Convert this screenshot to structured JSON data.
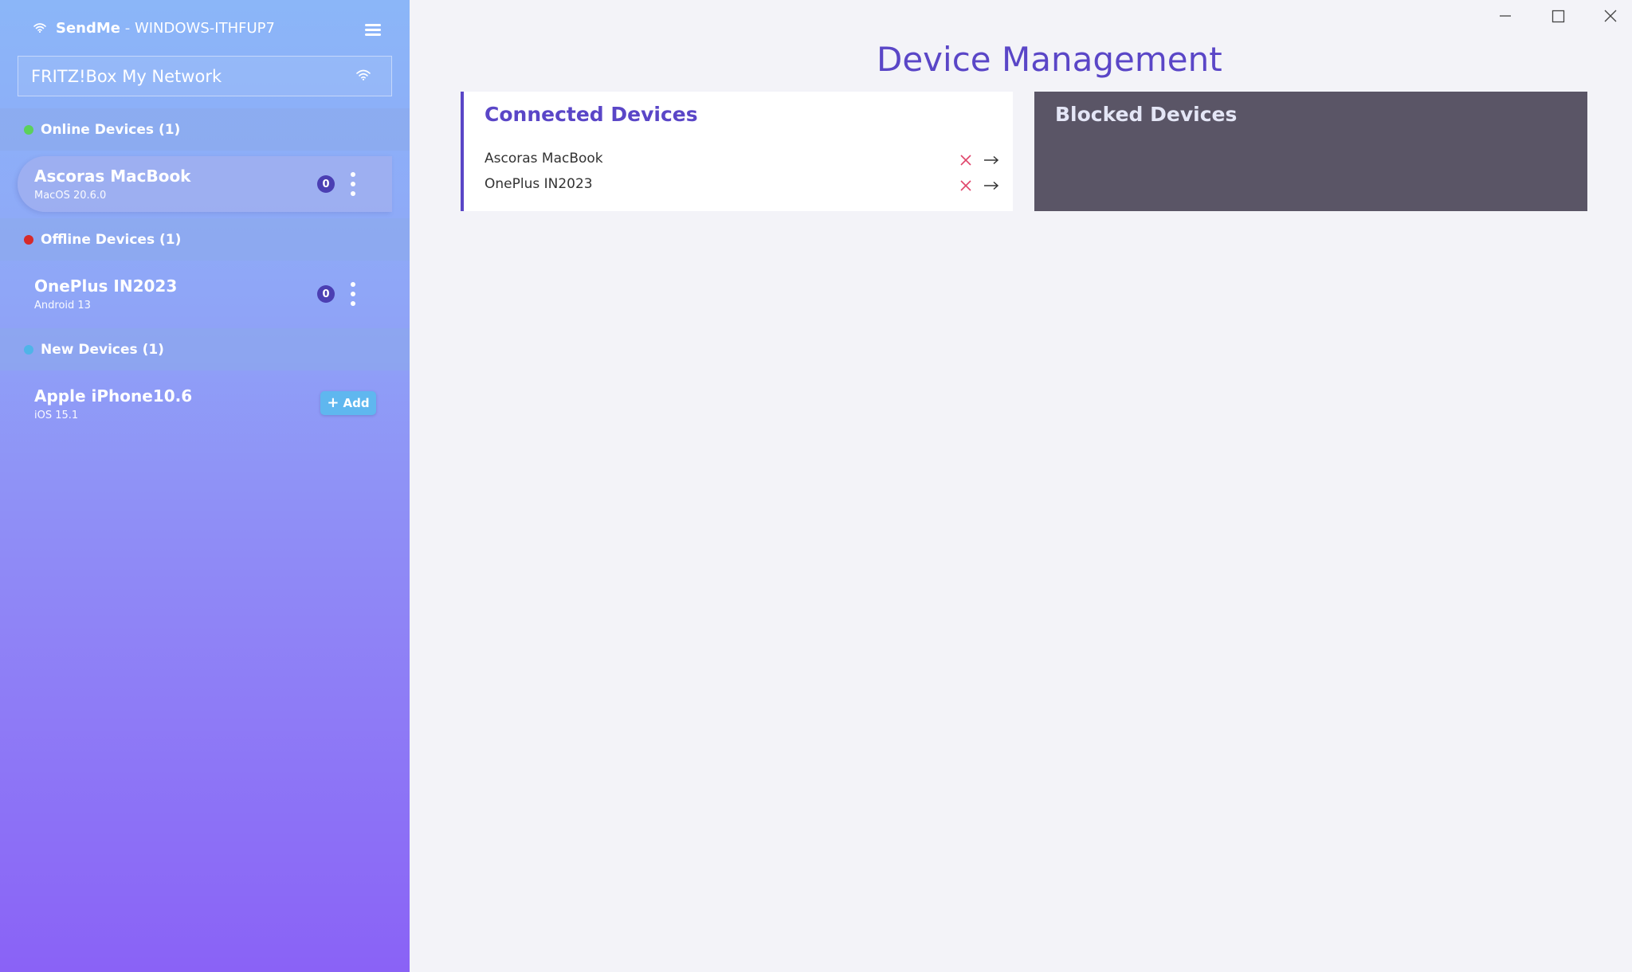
{
  "window": {
    "app_name": "SendMe",
    "separator": " - ",
    "host": "WINDOWS-ITHFUP7"
  },
  "network": {
    "selected": "FRITZ!Box My Network"
  },
  "sections": {
    "online": {
      "label": "Online Devices (1)",
      "color": "#5bd15b"
    },
    "offline": {
      "label": "Offline Devices (1)",
      "color": "#d62a2a"
    },
    "new": {
      "label": "New Devices (1)",
      "color": "#4fb4e8"
    }
  },
  "devices": {
    "online": [
      {
        "name": "Ascoras MacBook",
        "os": "MacOS 20.6.0",
        "badge": "0",
        "selected": true
      }
    ],
    "offline": [
      {
        "name": "OnePlus IN2023",
        "os": "Android 13",
        "badge": "0"
      }
    ],
    "new": [
      {
        "name": "Apple iPhone10.6",
        "os": "iOS 15.1",
        "add_label": "Add"
      }
    ]
  },
  "main": {
    "title": "Device Management",
    "connected": {
      "title": "Connected Devices",
      "items": [
        {
          "label": "Ascoras MacBook"
        },
        {
          "label": "OnePlus IN2023"
        }
      ]
    },
    "blocked": {
      "title": "Blocked Devices",
      "items": []
    }
  },
  "colors": {
    "accent": "#5a46c7",
    "remove": "#e0456b",
    "blocked_panel": "#5a5566",
    "add_button": "#5fb7ef"
  }
}
